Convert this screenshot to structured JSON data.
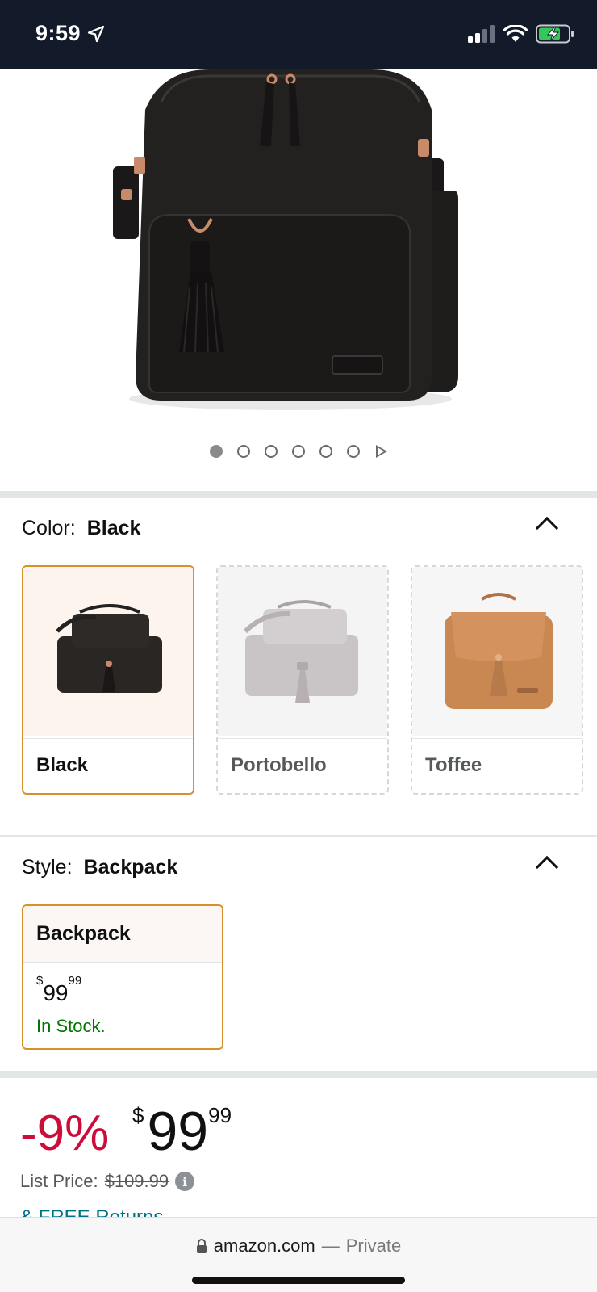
{
  "status": {
    "time": "9:59"
  },
  "gallery": {
    "image_count": 6,
    "active_index": 0
  },
  "color": {
    "label": "Color:",
    "selected": "Black",
    "options": [
      {
        "name": "Black",
        "selected": true,
        "tone": "#2a2623",
        "bg": "#fdf5ed"
      },
      {
        "name": "Portobello",
        "selected": false,
        "tone": "#c9c4c6",
        "bg": "#f4f4f4"
      },
      {
        "name": "Toffee",
        "selected": false,
        "tone": "#c98752",
        "bg": "#f6f6f6"
      }
    ]
  },
  "style": {
    "label": "Style:",
    "selected": "Backpack",
    "card": {
      "name": "Backpack",
      "currency": "$",
      "whole": "99",
      "fraction": "99",
      "stock": "In Stock."
    }
  },
  "price": {
    "discount": "-9%",
    "currency": "$",
    "whole": "99",
    "fraction": "99",
    "list_label": "List Price:",
    "list_value": "$109.99",
    "returns_text": "& FREE Returns"
  },
  "browser": {
    "domain": "amazon.com",
    "separator": "—",
    "mode": "Private"
  },
  "colors": {
    "accent": "#d98f2b",
    "deal": "#cc0c39",
    "stock": "#007600",
    "link": "#007185"
  }
}
